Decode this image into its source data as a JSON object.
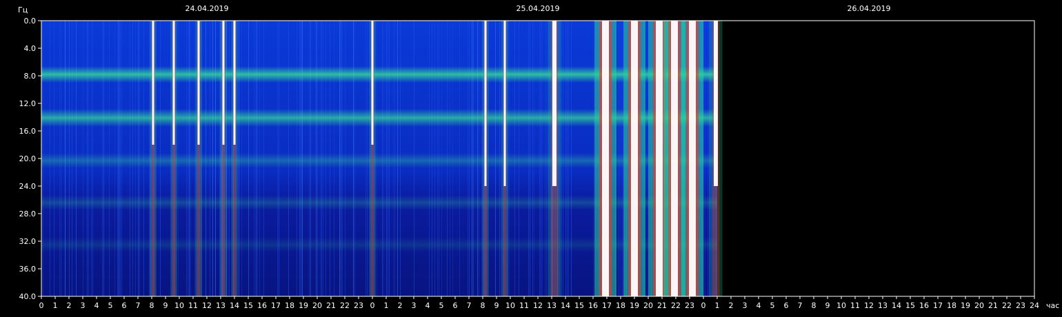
{
  "chart_data": {
    "type": "heatmap",
    "ylabel": "Гц",
    "xunit": "час",
    "ylim": [
      0,
      40
    ],
    "y_ticks": [
      "0.0",
      "4.0",
      "8.0",
      "12.0",
      "16.0",
      "20.0",
      "24.0",
      "28.0",
      "32.0",
      "36.0",
      "40.0"
    ],
    "dates": [
      "24.04.2019",
      "25.04.2019",
      "26.04.2019"
    ],
    "x_ticks": [
      "0",
      "1",
      "2",
      "3",
      "4",
      "5",
      "6",
      "7",
      "8",
      "9",
      "10",
      "11",
      "12",
      "13",
      "14",
      "15",
      "16",
      "17",
      "18",
      "19",
      "20",
      "21",
      "22",
      "23",
      "0",
      "1",
      "2",
      "3",
      "4",
      "5",
      "6",
      "7",
      "8",
      "9",
      "10",
      "11",
      "12",
      "13",
      "14",
      "15",
      "16",
      "17",
      "18",
      "19",
      "20",
      "21",
      "22",
      "23",
      "0",
      "1",
      "2",
      "3",
      "4",
      "5",
      "6",
      "7",
      "8",
      "9",
      "10",
      "11",
      "12",
      "13",
      "14",
      "15",
      "16",
      "17",
      "18",
      "19",
      "20",
      "21",
      "22",
      "23",
      "24"
    ],
    "data_end_hour": 49,
    "bands_hz": [
      7.8,
      14.1,
      20.3,
      26.4,
      32.5
    ],
    "bursts_hours": [
      8.1,
      9.6,
      11.4,
      13.2,
      14.0,
      24.0,
      32.2,
      33.6,
      37.2,
      40.9,
      43.0,
      44.8,
      45.9,
      47.2,
      48.9
    ],
    "colors": {
      "background": "#000000",
      "low": "#0a1aa0",
      "mid": "#2a6cff",
      "band": "#30e890",
      "high": "#ffffff",
      "hot": "#ff3020"
    }
  }
}
